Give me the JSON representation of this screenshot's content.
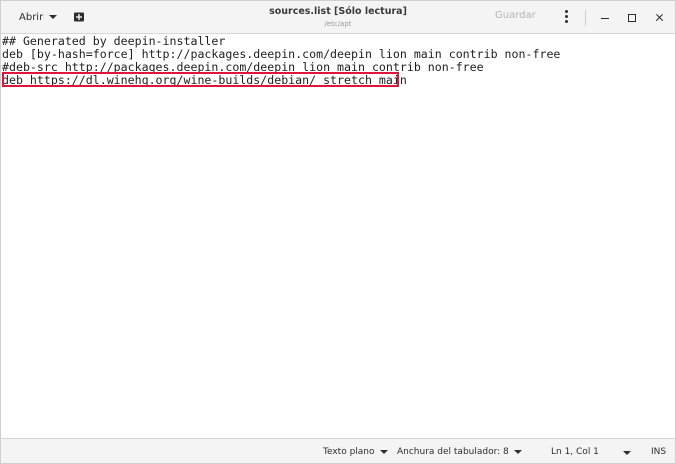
{
  "window": {
    "title": "sources.list [Sólo lectura]",
    "subtitle": "/etc/apt"
  },
  "headerbar": {
    "open_label": "Abrir",
    "save_label": "Guardar",
    "new_doc_icon": "new-document-icon",
    "menu_icon": "kebab-menu-icon"
  },
  "editor": {
    "lines": [
      "## Generated by deepin-installer",
      "deb [by-hash=force] http://packages.deepin.com/deepin lion main contrib non-free",
      "#deb-src http://packages.deepin.com/deepin lion main contrib non-free",
      "deb https://dl.winehq.org/wine-builds/debian/ stretch main"
    ],
    "highlight_color": "#e0153a"
  },
  "statusbar": {
    "language": "Texto plano",
    "tab_width": "Anchura del tabulador: 8",
    "position": "Ln 1, Col 1",
    "mode": "INS"
  }
}
